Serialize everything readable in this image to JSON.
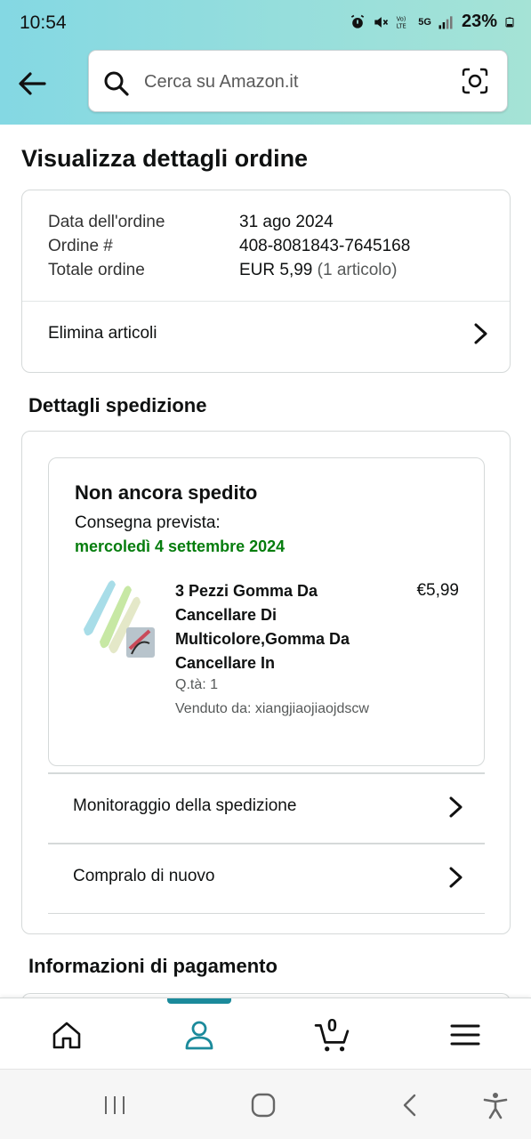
{
  "status_bar": {
    "time": "10:54",
    "network_text": "5G",
    "battery": "23%"
  },
  "header": {
    "search_placeholder": "Cerca su Amazon.it"
  },
  "page": {
    "title": "Visualizza dettagli ordine"
  },
  "order": {
    "date_label": "Data dell'ordine",
    "date_value": "31 ago 2024",
    "number_label": "Ordine #",
    "number_value": "408-8081843-7645168",
    "total_label": "Totale ordine",
    "total_value": "EUR 5,99",
    "total_items": "(1 articolo)",
    "delete_items_label": "Elimina articoli"
  },
  "shipment": {
    "section_title": "Dettagli spedizione",
    "status": "Non ancora spedito",
    "delivery_label": "Consegna prevista:",
    "delivery_date": "mercoledì 4 settembre 2024",
    "product": {
      "title": "3 Pezzi Gomma Da Cancellare Di Multicolore,Gomma Da Cancellare In",
      "price": "€5,99",
      "qty": "Q.tà: 1",
      "seller": "Venduto da: xiangjiaojiaojdscw"
    },
    "track_label": "Monitoraggio della spedizione",
    "buy_again_label": "Compralo di nuovo"
  },
  "payment": {
    "section_title": "Informazioni di pagamento"
  },
  "bottom_nav": {
    "cart_count": "0",
    "items": [
      "home-icon",
      "account-icon",
      "cart-icon",
      "menu-icon"
    ],
    "active": "account-icon"
  },
  "colors": {
    "header_gradient_start": "#84d8e3",
    "header_gradient_end": "#a5e3d6",
    "delivery_green": "#067d0e",
    "active_teal": "#1b8a9b"
  }
}
